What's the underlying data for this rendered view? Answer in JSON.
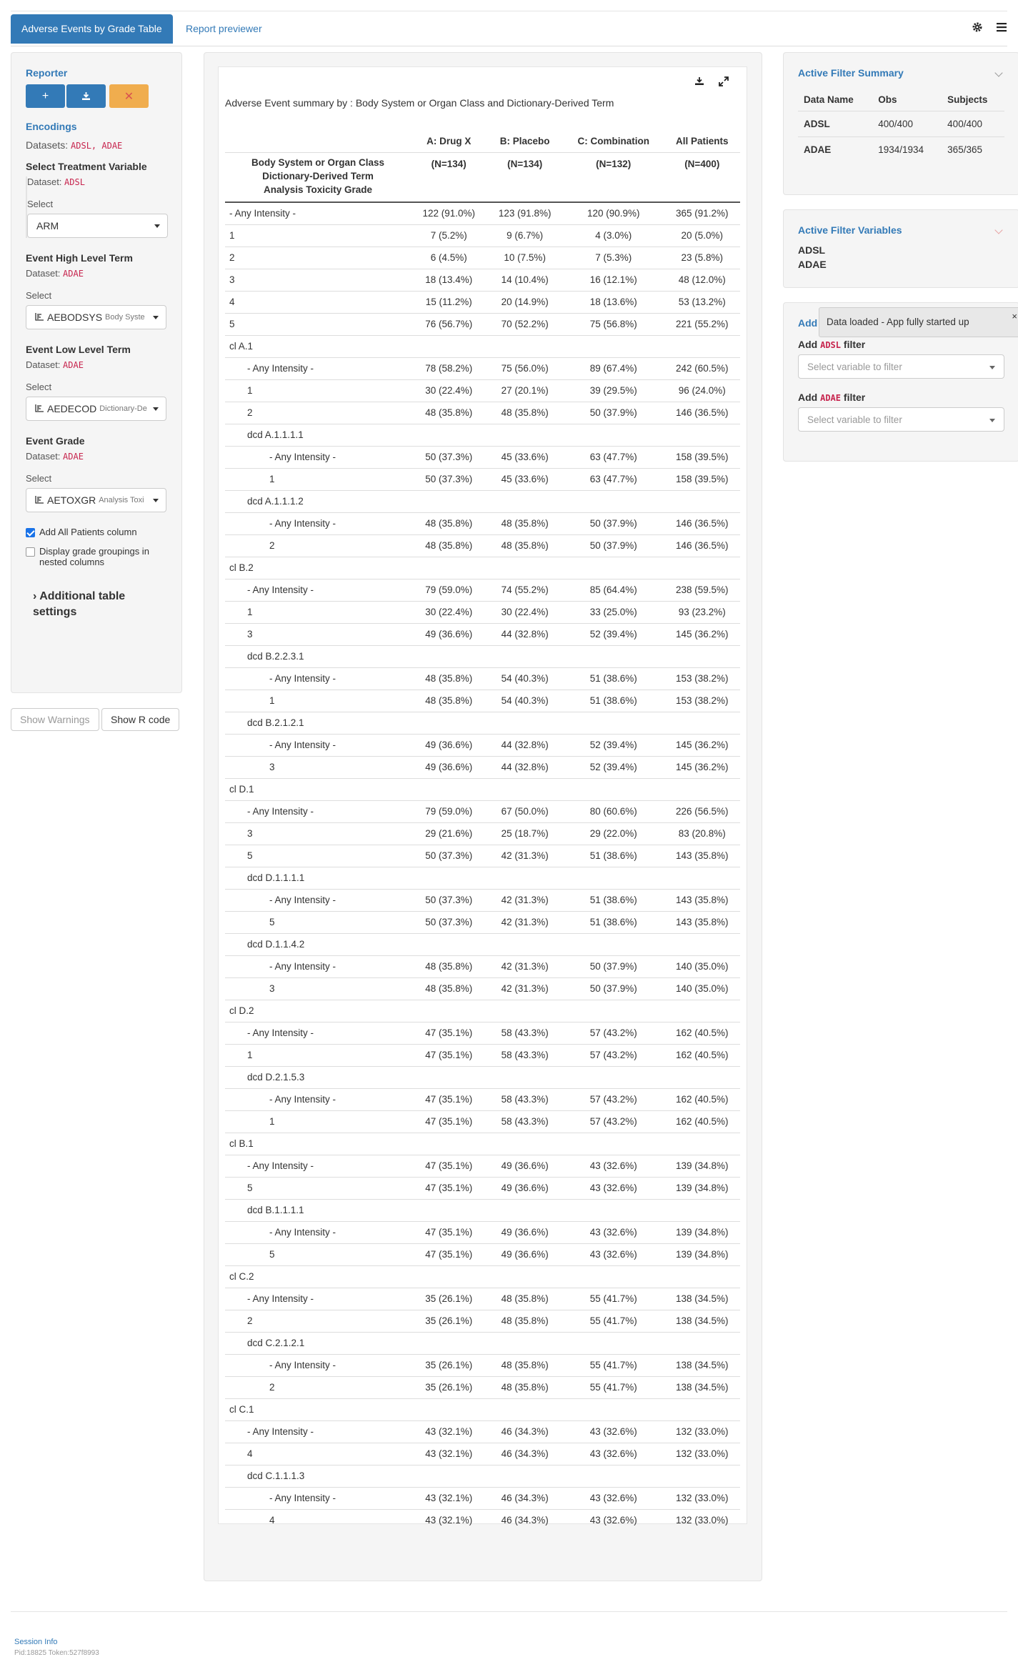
{
  "nav": {
    "active_tab": "Adverse Events by Grade Table",
    "tab_previewer": "Report previewer"
  },
  "encodings": {
    "reporter": "Reporter",
    "title": "Encodings",
    "datasets_label": "Datasets:",
    "datasets_value": "ADSL, ADAE",
    "treatment": {
      "title": "Select Treatment Variable",
      "dataset_label": "Dataset:",
      "dataset": "ADSL",
      "select_label": "Select",
      "value": "ARM",
      "sub": ""
    },
    "high": {
      "title": "Event High Level Term",
      "dataset_label": "Dataset:",
      "dataset": "ADAE",
      "select_label": "Select",
      "value": "AEBODSYS",
      "sub": "Body Syste"
    },
    "low": {
      "title": "Event Low Level Term",
      "dataset_label": "Dataset:",
      "dataset": "ADAE",
      "select_label": "Select",
      "value": "AEDECOD",
      "sub": "Dictionary-De"
    },
    "grade": {
      "title": "Event Grade",
      "dataset_label": "Dataset:",
      "dataset": "ADAE",
      "select_label": "Select",
      "value": "AETOXGR",
      "sub": "Analysis Toxi"
    },
    "add_all_patients": "Add All Patients column",
    "display_grade_groupings": "Display grade groupings in nested columns",
    "additional_settings": "Additional table settings"
  },
  "buttons": {
    "show_warnings": "Show Warnings",
    "show_r_code": "Show R code"
  },
  "table": {
    "title": "Adverse Event summary by : Body System or Organ Class and Dictionary-Derived Term",
    "row_header_lines": [
      "Body System or Organ Class",
      "Dictionary-Derived Term",
      "Analysis Toxicity Grade"
    ],
    "columns": [
      "A: Drug X",
      "B: Placebo",
      "C: Combination",
      "All Patients"
    ],
    "ns": [
      "(N=134)",
      "(N=134)",
      "(N=132)",
      "(N=400)"
    ],
    "rows": [
      {
        "label": "- Any Intensity -",
        "lvl": 0,
        "v": [
          "122 (91.0%)",
          "123 (91.8%)",
          "120 (90.9%)",
          "365 (91.2%)"
        ]
      },
      {
        "label": "1",
        "lvl": 0,
        "v": [
          "7 (5.2%)",
          "9 (6.7%)",
          "4 (3.0%)",
          "20 (5.0%)"
        ]
      },
      {
        "label": "2",
        "lvl": 0,
        "v": [
          "6 (4.5%)",
          "10 (7.5%)",
          "7 (5.3%)",
          "23 (5.8%)"
        ]
      },
      {
        "label": "3",
        "lvl": 0,
        "v": [
          "18 (13.4%)",
          "14 (10.4%)",
          "16 (12.1%)",
          "48 (12.0%)"
        ]
      },
      {
        "label": "4",
        "lvl": 0,
        "v": [
          "15 (11.2%)",
          "20 (14.9%)",
          "18 (13.6%)",
          "53 (13.2%)"
        ]
      },
      {
        "label": "5",
        "lvl": 0,
        "v": [
          "76 (56.7%)",
          "70 (52.2%)",
          "75 (56.8%)",
          "221 (55.2%)"
        ]
      },
      {
        "label": "cl A.1",
        "lvl": 0,
        "v": [
          "",
          "",
          "",
          ""
        ]
      },
      {
        "label": "- Any Intensity -",
        "lvl": 1,
        "v": [
          "78 (58.2%)",
          "75 (56.0%)",
          "89 (67.4%)",
          "242 (60.5%)"
        ]
      },
      {
        "label": "1",
        "lvl": 1,
        "v": [
          "30 (22.4%)",
          "27 (20.1%)",
          "39 (29.5%)",
          "96 (24.0%)"
        ]
      },
      {
        "label": "2",
        "lvl": 1,
        "v": [
          "48 (35.8%)",
          "48 (35.8%)",
          "50 (37.9%)",
          "146 (36.5%)"
        ]
      },
      {
        "label": "dcd A.1.1.1.1",
        "lvl": 1,
        "v": [
          "",
          "",
          "",
          ""
        ]
      },
      {
        "label": "- Any Intensity -",
        "lvl": 2,
        "v": [
          "50 (37.3%)",
          "45 (33.6%)",
          "63 (47.7%)",
          "158 (39.5%)"
        ]
      },
      {
        "label": "1",
        "lvl": 2,
        "v": [
          "50 (37.3%)",
          "45 (33.6%)",
          "63 (47.7%)",
          "158 (39.5%)"
        ]
      },
      {
        "label": "dcd A.1.1.1.2",
        "lvl": 1,
        "v": [
          "",
          "",
          "",
          ""
        ]
      },
      {
        "label": "- Any Intensity -",
        "lvl": 2,
        "v": [
          "48 (35.8%)",
          "48 (35.8%)",
          "50 (37.9%)",
          "146 (36.5%)"
        ]
      },
      {
        "label": "2",
        "lvl": 2,
        "v": [
          "48 (35.8%)",
          "48 (35.8%)",
          "50 (37.9%)",
          "146 (36.5%)"
        ]
      },
      {
        "label": "cl B.2",
        "lvl": 0,
        "v": [
          "",
          "",
          "",
          ""
        ]
      },
      {
        "label": "- Any Intensity -",
        "lvl": 1,
        "v": [
          "79 (59.0%)",
          "74 (55.2%)",
          "85 (64.4%)",
          "238 (59.5%)"
        ]
      },
      {
        "label": "1",
        "lvl": 1,
        "v": [
          "30 (22.4%)",
          "30 (22.4%)",
          "33 (25.0%)",
          "93 (23.2%)"
        ]
      },
      {
        "label": "3",
        "lvl": 1,
        "v": [
          "49 (36.6%)",
          "44 (32.8%)",
          "52 (39.4%)",
          "145 (36.2%)"
        ]
      },
      {
        "label": "dcd B.2.2.3.1",
        "lvl": 1,
        "v": [
          "",
          "",
          "",
          ""
        ]
      },
      {
        "label": "- Any Intensity -",
        "lvl": 2,
        "v": [
          "48 (35.8%)",
          "54 (40.3%)",
          "51 (38.6%)",
          "153 (38.2%)"
        ]
      },
      {
        "label": "1",
        "lvl": 2,
        "v": [
          "48 (35.8%)",
          "54 (40.3%)",
          "51 (38.6%)",
          "153 (38.2%)"
        ]
      },
      {
        "label": "dcd B.2.1.2.1",
        "lvl": 1,
        "v": [
          "",
          "",
          "",
          ""
        ]
      },
      {
        "label": "- Any Intensity -",
        "lvl": 2,
        "v": [
          "49 (36.6%)",
          "44 (32.8%)",
          "52 (39.4%)",
          "145 (36.2%)"
        ]
      },
      {
        "label": "3",
        "lvl": 2,
        "v": [
          "49 (36.6%)",
          "44 (32.8%)",
          "52 (39.4%)",
          "145 (36.2%)"
        ]
      },
      {
        "label": "cl D.1",
        "lvl": 0,
        "v": [
          "",
          "",
          "",
          ""
        ]
      },
      {
        "label": "- Any Intensity -",
        "lvl": 1,
        "v": [
          "79 (59.0%)",
          "67 (50.0%)",
          "80 (60.6%)",
          "226 (56.5%)"
        ]
      },
      {
        "label": "3",
        "lvl": 1,
        "v": [
          "29 (21.6%)",
          "25 (18.7%)",
          "29 (22.0%)",
          "83 (20.8%)"
        ]
      },
      {
        "label": "5",
        "lvl": 1,
        "v": [
          "50 (37.3%)",
          "42 (31.3%)",
          "51 (38.6%)",
          "143 (35.8%)"
        ]
      },
      {
        "label": "dcd D.1.1.1.1",
        "lvl": 1,
        "v": [
          "",
          "",
          "",
          ""
        ]
      },
      {
        "label": "- Any Intensity -",
        "lvl": 2,
        "v": [
          "50 (37.3%)",
          "42 (31.3%)",
          "51 (38.6%)",
          "143 (35.8%)"
        ]
      },
      {
        "label": "5",
        "lvl": 2,
        "v": [
          "50 (37.3%)",
          "42 (31.3%)",
          "51 (38.6%)",
          "143 (35.8%)"
        ]
      },
      {
        "label": "dcd D.1.1.4.2",
        "lvl": 1,
        "v": [
          "",
          "",
          "",
          ""
        ]
      },
      {
        "label": "- Any Intensity -",
        "lvl": 2,
        "v": [
          "48 (35.8%)",
          "42 (31.3%)",
          "50 (37.9%)",
          "140 (35.0%)"
        ]
      },
      {
        "label": "3",
        "lvl": 2,
        "v": [
          "48 (35.8%)",
          "42 (31.3%)",
          "50 (37.9%)",
          "140 (35.0%)"
        ]
      },
      {
        "label": "cl D.2",
        "lvl": 0,
        "v": [
          "",
          "",
          "",
          ""
        ]
      },
      {
        "label": "- Any Intensity -",
        "lvl": 1,
        "v": [
          "47 (35.1%)",
          "58 (43.3%)",
          "57 (43.2%)",
          "162 (40.5%)"
        ]
      },
      {
        "label": "1",
        "lvl": 1,
        "v": [
          "47 (35.1%)",
          "58 (43.3%)",
          "57 (43.2%)",
          "162 (40.5%)"
        ]
      },
      {
        "label": "dcd D.2.1.5.3",
        "lvl": 1,
        "v": [
          "",
          "",
          "",
          ""
        ]
      },
      {
        "label": "- Any Intensity -",
        "lvl": 2,
        "v": [
          "47 (35.1%)",
          "58 (43.3%)",
          "57 (43.2%)",
          "162 (40.5%)"
        ]
      },
      {
        "label": "1",
        "lvl": 2,
        "v": [
          "47 (35.1%)",
          "58 (43.3%)",
          "57 (43.2%)",
          "162 (40.5%)"
        ]
      },
      {
        "label": "cl B.1",
        "lvl": 0,
        "v": [
          "",
          "",
          "",
          ""
        ]
      },
      {
        "label": "- Any Intensity -",
        "lvl": 1,
        "v": [
          "47 (35.1%)",
          "49 (36.6%)",
          "43 (32.6%)",
          "139 (34.8%)"
        ]
      },
      {
        "label": "5",
        "lvl": 1,
        "v": [
          "47 (35.1%)",
          "49 (36.6%)",
          "43 (32.6%)",
          "139 (34.8%)"
        ]
      },
      {
        "label": "dcd B.1.1.1.1",
        "lvl": 1,
        "v": [
          "",
          "",
          "",
          ""
        ]
      },
      {
        "label": "- Any Intensity -",
        "lvl": 2,
        "v": [
          "47 (35.1%)",
          "49 (36.6%)",
          "43 (32.6%)",
          "139 (34.8%)"
        ]
      },
      {
        "label": "5",
        "lvl": 2,
        "v": [
          "47 (35.1%)",
          "49 (36.6%)",
          "43 (32.6%)",
          "139 (34.8%)"
        ]
      },
      {
        "label": "cl C.2",
        "lvl": 0,
        "v": [
          "",
          "",
          "",
          ""
        ]
      },
      {
        "label": "- Any Intensity -",
        "lvl": 1,
        "v": [
          "35 (26.1%)",
          "48 (35.8%)",
          "55 (41.7%)",
          "138 (34.5%)"
        ]
      },
      {
        "label": "2",
        "lvl": 1,
        "v": [
          "35 (26.1%)",
          "48 (35.8%)",
          "55 (41.7%)",
          "138 (34.5%)"
        ]
      },
      {
        "label": "dcd C.2.1.2.1",
        "lvl": 1,
        "v": [
          "",
          "",
          "",
          ""
        ]
      },
      {
        "label": "- Any Intensity -",
        "lvl": 2,
        "v": [
          "35 (26.1%)",
          "48 (35.8%)",
          "55 (41.7%)",
          "138 (34.5%)"
        ]
      },
      {
        "label": "2",
        "lvl": 2,
        "v": [
          "35 (26.1%)",
          "48 (35.8%)",
          "55 (41.7%)",
          "138 (34.5%)"
        ]
      },
      {
        "label": "cl C.1",
        "lvl": 0,
        "v": [
          "",
          "",
          "",
          ""
        ]
      },
      {
        "label": "- Any Intensity -",
        "lvl": 1,
        "v": [
          "43 (32.1%)",
          "46 (34.3%)",
          "43 (32.6%)",
          "132 (33.0%)"
        ]
      },
      {
        "label": "4",
        "lvl": 1,
        "v": [
          "43 (32.1%)",
          "46 (34.3%)",
          "43 (32.6%)",
          "132 (33.0%)"
        ]
      },
      {
        "label": "dcd C.1.1.1.3",
        "lvl": 1,
        "v": [
          "",
          "",
          "",
          ""
        ]
      },
      {
        "label": "- Any Intensity -",
        "lvl": 2,
        "v": [
          "43 (32.1%)",
          "46 (34.3%)",
          "43 (32.6%)",
          "132 (33.0%)"
        ]
      },
      {
        "label": "4",
        "lvl": 2,
        "v": [
          "43 (32.1%)",
          "46 (34.3%)",
          "43 (32.6%)",
          "132 (33.0%)"
        ]
      }
    ]
  },
  "filter_summary": {
    "title": "Active Filter Summary",
    "headers": [
      "Data Name",
      "Obs",
      "Subjects"
    ],
    "rows": [
      [
        "ADSL",
        "400/400",
        "400/400"
      ],
      [
        "ADAE",
        "1934/1934",
        "365/365"
      ]
    ]
  },
  "filter_vars": {
    "title": "Active Filter Variables",
    "items": [
      "ADSL",
      "ADAE"
    ]
  },
  "add_filter": {
    "title": "Add",
    "add_word": "Add",
    "filter_word": "filter",
    "adsl": "ADSL",
    "adae": "ADAE",
    "placeholder": "Select variable to filter"
  },
  "toast": {
    "text": "Data loaded - App fully started up",
    "close": "×"
  },
  "footer": {
    "session_info": "Session Info",
    "pid": "Pid:18825 Token:527f8993"
  },
  "colors": {
    "primary": "#337ab7",
    "warning": "#f0ad4e",
    "code": "#c7254e"
  }
}
